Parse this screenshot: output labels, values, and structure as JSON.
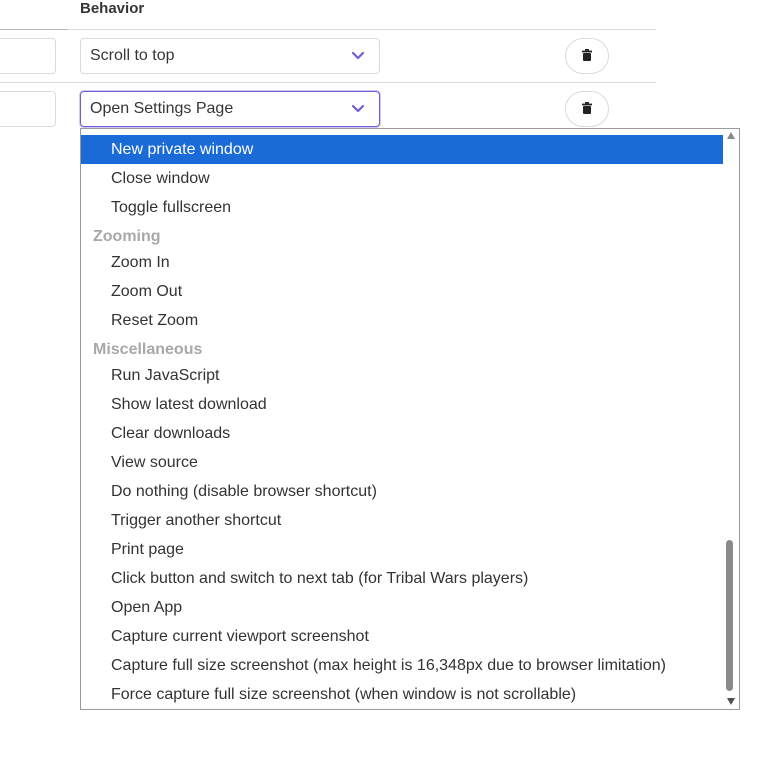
{
  "table": {
    "behavior_header": "Behavior"
  },
  "rows": [
    {
      "behavior_value": "Scroll to top"
    },
    {
      "behavior_value": "Open Settings Page"
    }
  ],
  "dropdown": {
    "selected_index": 0,
    "items": [
      {
        "kind": "option",
        "label": "New private window"
      },
      {
        "kind": "option",
        "label": "Close window"
      },
      {
        "kind": "option",
        "label": "Toggle fullscreen"
      },
      {
        "kind": "group",
        "label": "Zooming"
      },
      {
        "kind": "option",
        "label": "Zoom In"
      },
      {
        "kind": "option",
        "label": "Zoom Out"
      },
      {
        "kind": "option",
        "label": "Reset Zoom"
      },
      {
        "kind": "group",
        "label": "Miscellaneous"
      },
      {
        "kind": "option",
        "label": "Run JavaScript"
      },
      {
        "kind": "option",
        "label": "Show latest download"
      },
      {
        "kind": "option",
        "label": "Clear downloads"
      },
      {
        "kind": "option",
        "label": "View source"
      },
      {
        "kind": "option",
        "label": "Do nothing (disable browser shortcut)"
      },
      {
        "kind": "option",
        "label": "Trigger another shortcut"
      },
      {
        "kind": "option",
        "label": "Print page"
      },
      {
        "kind": "option",
        "label": "Click button and switch to next tab (for Tribal Wars players)"
      },
      {
        "kind": "option",
        "label": "Open App"
      },
      {
        "kind": "option",
        "label": "Capture current viewport screenshot"
      },
      {
        "kind": "option",
        "label": "Capture full size screenshot (max height is 16,348px due to browser limitation)"
      },
      {
        "kind": "option",
        "label": "Force capture full size screenshot (when window is not scrollable)"
      }
    ]
  },
  "icons": {
    "select_chevron": "chevron-down-icon",
    "delete": "trash-icon"
  },
  "colors": {
    "selected_option_bg": "#1a6ad8",
    "focus_border": "#6f5fd8",
    "chevron": "#6f5fd8",
    "group_label": "#a8a8a8"
  }
}
